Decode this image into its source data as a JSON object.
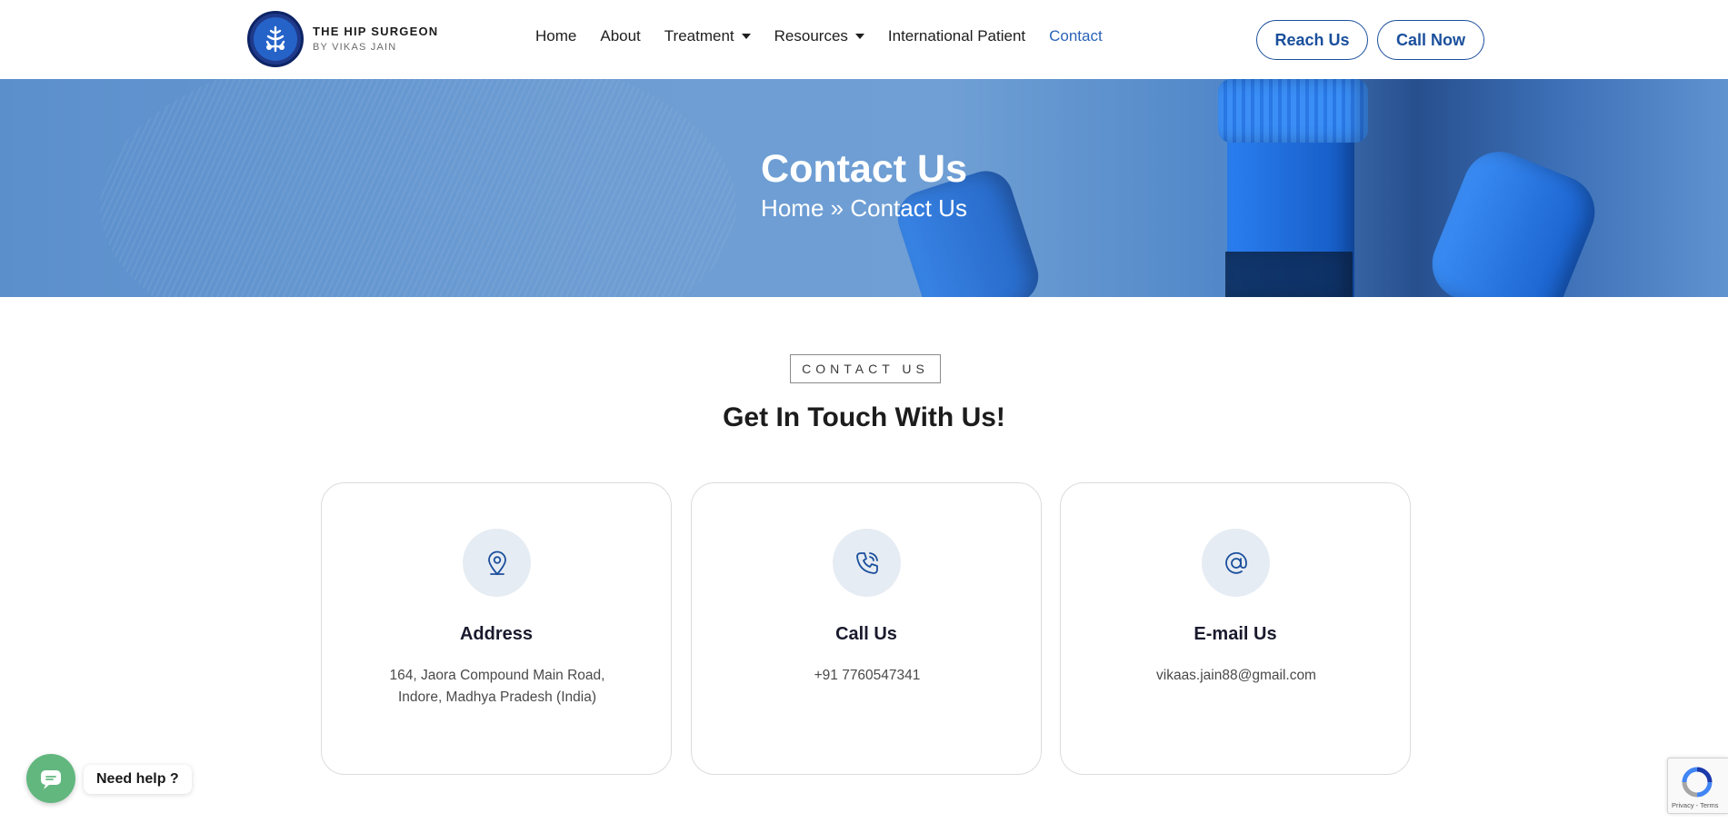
{
  "brand": {
    "title": "THE HIP SURGEON",
    "subtitle": "BY VIKAS JAIN"
  },
  "nav": {
    "items": [
      {
        "label": "Home"
      },
      {
        "label": "About"
      },
      {
        "label": "Treatment"
      },
      {
        "label": "Resources"
      },
      {
        "label": "International Patient"
      },
      {
        "label": "Contact"
      }
    ],
    "active": "Contact"
  },
  "header_buttons": {
    "reach": "Reach Us",
    "call": "Call Now"
  },
  "hero": {
    "title": "Contact Us",
    "breadcrumb_home": "Home",
    "breadcrumb_sep": "»",
    "breadcrumb_current": "Contact Us"
  },
  "section": {
    "eyebrow": "CONTACT US",
    "title": "Get In Touch With Us!"
  },
  "cards": [
    {
      "icon": "location-pin-icon",
      "title": "Address",
      "text": "164, Jaora Compound Main Road, Indore, Madhya Pradesh (India)"
    },
    {
      "icon": "phone-icon",
      "title": "Call Us",
      "text": "+91 7760547341"
    },
    {
      "icon": "at-sign-icon",
      "title": "E-mail Us",
      "text": "vikaas.jain88@gmail.com"
    }
  ],
  "chat": {
    "label": "Need help ?",
    "color": "#62b77f"
  },
  "recaptcha": {
    "terms": "Privacy - Terms"
  },
  "colors": {
    "accent": "#1a4f9c",
    "nav_active": "#2b63b8",
    "hero_blue": "#5b8fcc"
  }
}
